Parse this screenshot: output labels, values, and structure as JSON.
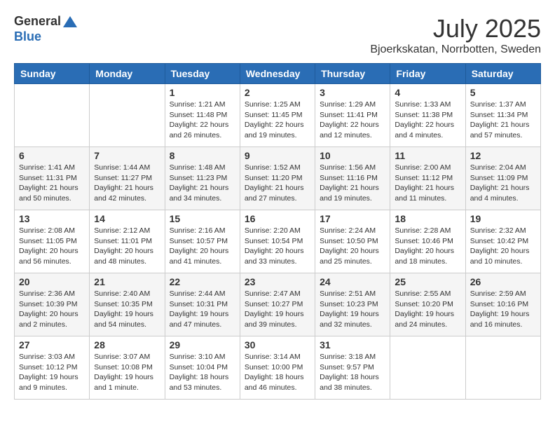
{
  "header": {
    "logo_general": "General",
    "logo_blue": "Blue",
    "month": "July 2025",
    "location": "Bjoerkskatan, Norrbotten, Sweden"
  },
  "weekdays": [
    "Sunday",
    "Monday",
    "Tuesday",
    "Wednesday",
    "Thursday",
    "Friday",
    "Saturday"
  ],
  "weeks": [
    [
      {
        "day": "",
        "info": ""
      },
      {
        "day": "",
        "info": ""
      },
      {
        "day": "1",
        "info": "Sunrise: 1:21 AM\nSunset: 11:48 PM\nDaylight: 22 hours and 26 minutes."
      },
      {
        "day": "2",
        "info": "Sunrise: 1:25 AM\nSunset: 11:45 PM\nDaylight: 22 hours and 19 minutes."
      },
      {
        "day": "3",
        "info": "Sunrise: 1:29 AM\nSunset: 11:41 PM\nDaylight: 22 hours and 12 minutes."
      },
      {
        "day": "4",
        "info": "Sunrise: 1:33 AM\nSunset: 11:38 PM\nDaylight: 22 hours and 4 minutes."
      },
      {
        "day": "5",
        "info": "Sunrise: 1:37 AM\nSunset: 11:34 PM\nDaylight: 21 hours and 57 minutes."
      }
    ],
    [
      {
        "day": "6",
        "info": "Sunrise: 1:41 AM\nSunset: 11:31 PM\nDaylight: 21 hours and 50 minutes."
      },
      {
        "day": "7",
        "info": "Sunrise: 1:44 AM\nSunset: 11:27 PM\nDaylight: 21 hours and 42 minutes."
      },
      {
        "day": "8",
        "info": "Sunrise: 1:48 AM\nSunset: 11:23 PM\nDaylight: 21 hours and 34 minutes."
      },
      {
        "day": "9",
        "info": "Sunrise: 1:52 AM\nSunset: 11:20 PM\nDaylight: 21 hours and 27 minutes."
      },
      {
        "day": "10",
        "info": "Sunrise: 1:56 AM\nSunset: 11:16 PM\nDaylight: 21 hours and 19 minutes."
      },
      {
        "day": "11",
        "info": "Sunrise: 2:00 AM\nSunset: 11:12 PM\nDaylight: 21 hours and 11 minutes."
      },
      {
        "day": "12",
        "info": "Sunrise: 2:04 AM\nSunset: 11:09 PM\nDaylight: 21 hours and 4 minutes."
      }
    ],
    [
      {
        "day": "13",
        "info": "Sunrise: 2:08 AM\nSunset: 11:05 PM\nDaylight: 20 hours and 56 minutes."
      },
      {
        "day": "14",
        "info": "Sunrise: 2:12 AM\nSunset: 11:01 PM\nDaylight: 20 hours and 48 minutes."
      },
      {
        "day": "15",
        "info": "Sunrise: 2:16 AM\nSunset: 10:57 PM\nDaylight: 20 hours and 41 minutes."
      },
      {
        "day": "16",
        "info": "Sunrise: 2:20 AM\nSunset: 10:54 PM\nDaylight: 20 hours and 33 minutes."
      },
      {
        "day": "17",
        "info": "Sunrise: 2:24 AM\nSunset: 10:50 PM\nDaylight: 20 hours and 25 minutes."
      },
      {
        "day": "18",
        "info": "Sunrise: 2:28 AM\nSunset: 10:46 PM\nDaylight: 20 hours and 18 minutes."
      },
      {
        "day": "19",
        "info": "Sunrise: 2:32 AM\nSunset: 10:42 PM\nDaylight: 20 hours and 10 minutes."
      }
    ],
    [
      {
        "day": "20",
        "info": "Sunrise: 2:36 AM\nSunset: 10:39 PM\nDaylight: 20 hours and 2 minutes."
      },
      {
        "day": "21",
        "info": "Sunrise: 2:40 AM\nSunset: 10:35 PM\nDaylight: 19 hours and 54 minutes."
      },
      {
        "day": "22",
        "info": "Sunrise: 2:44 AM\nSunset: 10:31 PM\nDaylight: 19 hours and 47 minutes."
      },
      {
        "day": "23",
        "info": "Sunrise: 2:47 AM\nSunset: 10:27 PM\nDaylight: 19 hours and 39 minutes."
      },
      {
        "day": "24",
        "info": "Sunrise: 2:51 AM\nSunset: 10:23 PM\nDaylight: 19 hours and 32 minutes."
      },
      {
        "day": "25",
        "info": "Sunrise: 2:55 AM\nSunset: 10:20 PM\nDaylight: 19 hours and 24 minutes."
      },
      {
        "day": "26",
        "info": "Sunrise: 2:59 AM\nSunset: 10:16 PM\nDaylight: 19 hours and 16 minutes."
      }
    ],
    [
      {
        "day": "27",
        "info": "Sunrise: 3:03 AM\nSunset: 10:12 PM\nDaylight: 19 hours and 9 minutes."
      },
      {
        "day": "28",
        "info": "Sunrise: 3:07 AM\nSunset: 10:08 PM\nDaylight: 19 hours and 1 minute."
      },
      {
        "day": "29",
        "info": "Sunrise: 3:10 AM\nSunset: 10:04 PM\nDaylight: 18 hours and 53 minutes."
      },
      {
        "day": "30",
        "info": "Sunrise: 3:14 AM\nSunset: 10:00 PM\nDaylight: 18 hours and 46 minutes."
      },
      {
        "day": "31",
        "info": "Sunrise: 3:18 AM\nSunset: 9:57 PM\nDaylight: 18 hours and 38 minutes."
      },
      {
        "day": "",
        "info": ""
      },
      {
        "day": "",
        "info": ""
      }
    ]
  ]
}
